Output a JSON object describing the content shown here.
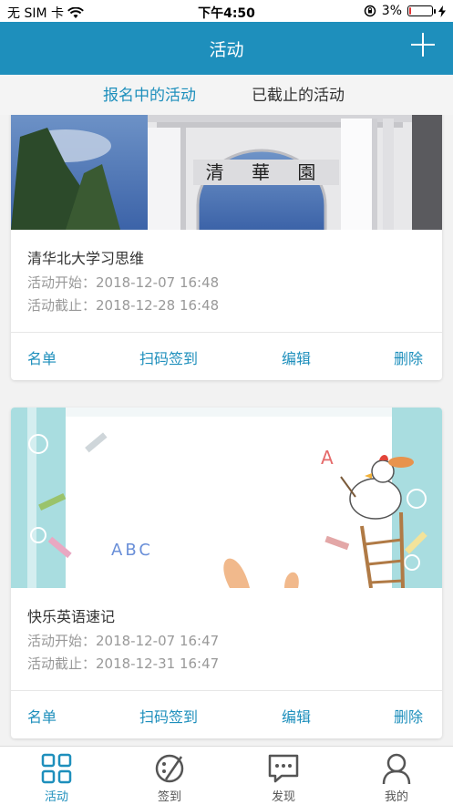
{
  "status_bar": {
    "carrier": "无 SIM 卡",
    "time": "下午4:50",
    "battery_percent": "3%",
    "battery_level": 0.03
  },
  "nav": {
    "title": "活动"
  },
  "tabs": {
    "active": "报名中的活动",
    "inactive": "已截止的活动"
  },
  "activities": [
    {
      "title": "清华北大学习思维",
      "start": "活动开始：2018-12-07 16:48",
      "end": "活动截止：2018-12-28 16:48",
      "actions": [
        "名单",
        "扫码签到",
        "编辑",
        "删除"
      ]
    },
    {
      "title": "快乐英语速记",
      "start": "活动开始：2018-12-07 16:47",
      "end": "活动截止：2018-12-31 16:47",
      "actions": [
        "名单",
        "扫码签到",
        "编辑",
        "删除"
      ]
    }
  ],
  "image_text": {
    "gate_characters": "清 華 園",
    "abc": "ABC",
    "a_letter": "A"
  },
  "tab_bar": {
    "items": [
      "活动",
      "签到",
      "发现",
      "我的"
    ]
  },
  "colors": {
    "accent": "#1e8fbc",
    "battery_low": "#e33333"
  }
}
